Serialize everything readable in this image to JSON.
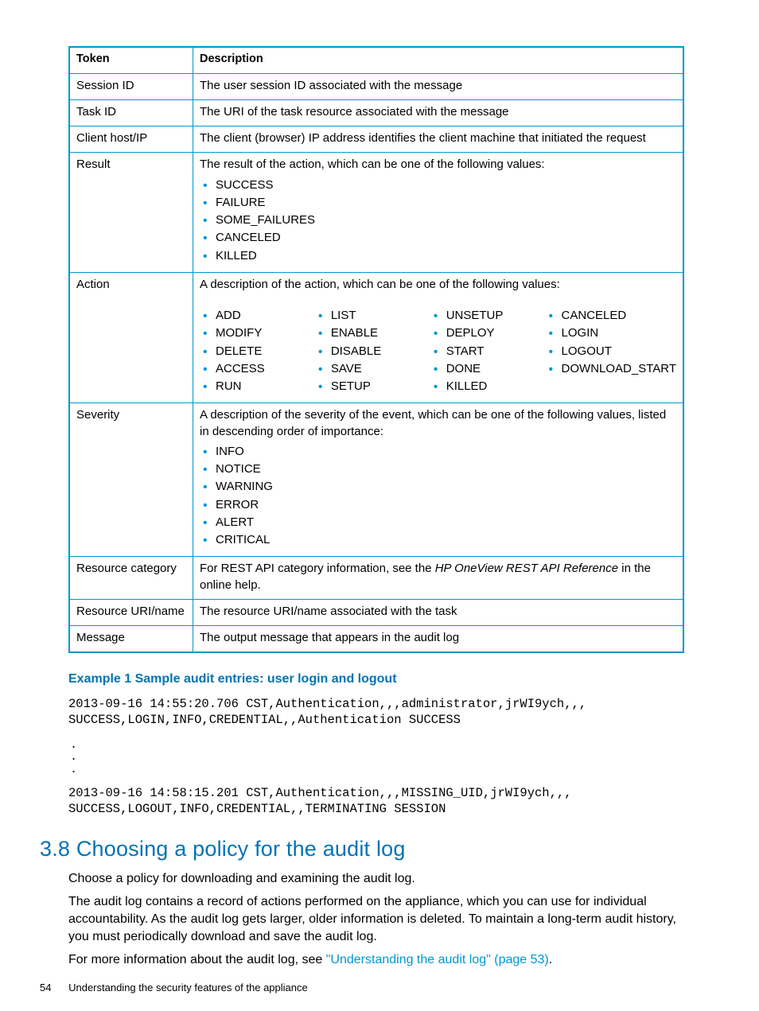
{
  "table": {
    "headers": [
      "Token",
      "Description"
    ],
    "rows": {
      "session_id": {
        "token": "Session ID",
        "desc": "The user session ID associated with the message"
      },
      "task_id": {
        "token": "Task ID",
        "desc": "The URI of the task resource associated with the message"
      },
      "client": {
        "token": "Client host/IP",
        "desc": "The client (browser) IP address identifies the client machine that initiated the request"
      },
      "result": {
        "token": "Result",
        "desc": "The result of the action, which can be one of the following values:",
        "items": [
          "SUCCESS",
          "FAILURE",
          "SOME_FAILURES",
          "CANCELED",
          "KILLED"
        ]
      },
      "action": {
        "token": "Action",
        "desc": "A description of the action, which can be one of the following values:",
        "col1": [
          "ADD",
          "MODIFY",
          "DELETE",
          "ACCESS",
          "RUN"
        ],
        "col2": [
          "LIST",
          "ENABLE",
          "DISABLE",
          "SAVE",
          "SETUP"
        ],
        "col3": [
          "UNSETUP",
          "DEPLOY",
          "START",
          "DONE",
          "KILLED"
        ],
        "col4": [
          "CANCELED",
          "LOGIN",
          "LOGOUT",
          "DOWNLOAD_START"
        ]
      },
      "severity": {
        "token": "Severity",
        "desc": "A description of the severity of the event, which can be one of the following values, listed in descending order of importance:",
        "items": [
          "INFO",
          "NOTICE",
          "WARNING",
          "ERROR",
          "ALERT",
          "CRITICAL"
        ]
      },
      "rescat": {
        "token": "Resource category",
        "desc_pre": "For REST API category information, see the ",
        "desc_em": "HP OneView REST API Reference",
        "desc_post": " in the online help."
      },
      "resuri": {
        "token": "Resource URI/name",
        "desc": "The resource URI/name associated with the task"
      },
      "message": {
        "token": "Message",
        "desc": "The output message that appears in the audit log"
      }
    }
  },
  "example": {
    "title": "Example 1 Sample audit entries: user login and logout",
    "block1": "2013-09-16 14:55:20.706 CST,Authentication,,,administrator,jrWI9ych,,,\nSUCCESS,LOGIN,INFO,CREDENTIAL,,Authentication SUCCESS",
    "block2": "2013-09-16 14:58:15.201 CST,Authentication,,,MISSING_UID,jrWI9ych,,,\nSUCCESS,LOGOUT,INFO,CREDENTIAL,,TERMINATING SESSION"
  },
  "section": {
    "heading": "3.8 Choosing a policy for the audit log",
    "p1": "Choose a policy for downloading and examining the audit log.",
    "p2": "The audit log contains a record of actions performed on the appliance, which you can use for individual accountability. As the audit log gets larger, older information is deleted. To maintain a long-term audit history, you must periodically download and save the audit log.",
    "p3_pre": "For more information about the audit log, see ",
    "p3_link": "\"Understanding the audit log\" (page 53)",
    "p3_post": "."
  },
  "footer": {
    "page": "54",
    "title": "Understanding the security features of the appliance"
  }
}
